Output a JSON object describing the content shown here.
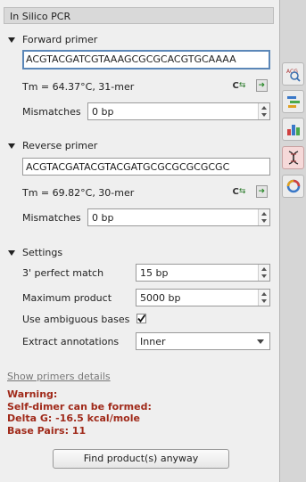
{
  "panel": {
    "title": "In Silico PCR"
  },
  "forward": {
    "header": "Forward primer",
    "sequence": "ACGTACGATCGTAAAGCGCGCACGTGCAAAA",
    "tm": "Tm = 64.37°C, 31-mer",
    "mismatches_label": "Mismatches",
    "mismatches_value": "0 bp"
  },
  "reverse": {
    "header": "Reverse primer",
    "sequence": "ACGTACGATACGTACGATGCGCGCGCGCGC",
    "tm": "Tm = 69.82°C, 30-mer",
    "mismatches_label": "Mismatches",
    "mismatches_value": "0 bp"
  },
  "settings": {
    "header": "Settings",
    "perfect_match_label": "3' perfect match",
    "perfect_match_value": "15 bp",
    "max_product_label": "Maximum product",
    "max_product_value": "5000 bp",
    "ambiguous_label": "Use ambiguous bases",
    "ambiguous_checked": true,
    "extract_label": "Extract annotations",
    "extract_value": "Inner"
  },
  "details_link": "Show primers details",
  "warning": {
    "line1": "Warning:",
    "line2": "Self-dimer can be formed:",
    "line3": "Delta G: -16.5 kcal/mole",
    "line4": "Base Pairs: 11"
  },
  "find_button": "Find product(s) anyway",
  "colors": {
    "warning": "#a02a1a",
    "focus": "#5b87b8",
    "active_tab": "#f6d9d9"
  },
  "sidebar_tools": [
    "sequence-view-icon",
    "annotations-icon",
    "statistics-icon",
    "pcr-icon",
    "circular-view-icon"
  ]
}
